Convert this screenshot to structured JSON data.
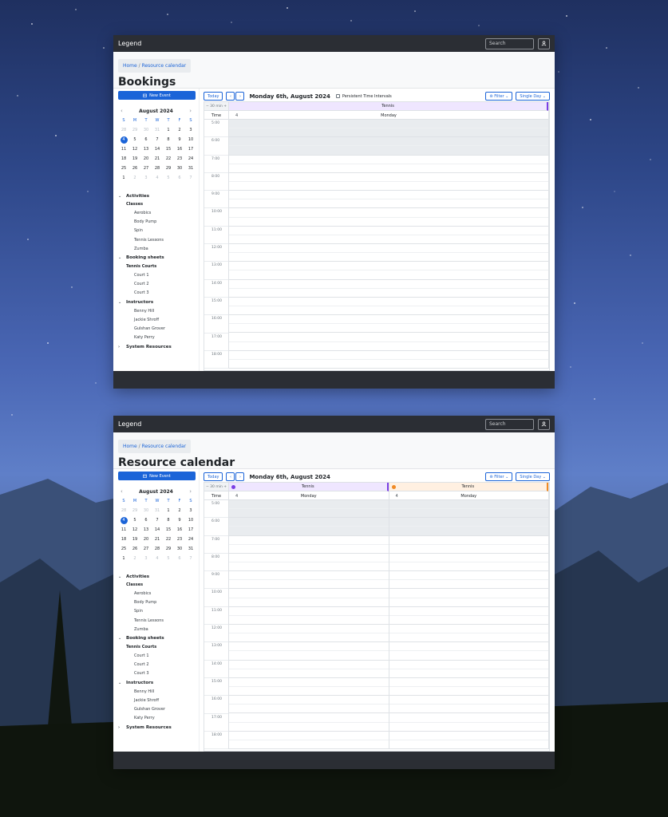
{
  "colors": {
    "accent": "#1b64d8",
    "navbar": "#2b2e34",
    "resource_purple": "#7b3fe4",
    "resource_orange": "#f08a24"
  },
  "navbar": {
    "brand": "Legend",
    "search_placeholder": "Search",
    "user_icon": "user-icon"
  },
  "windows": [
    {
      "breadcrumb": {
        "home": "Home",
        "separator": "/",
        "current": "Resource calendar"
      },
      "title": "Bookings",
      "resources": [
        {
          "name": "Tennis",
          "color": "#7b3fe4",
          "day_num": "4",
          "day": "Monday"
        }
      ]
    },
    {
      "breadcrumb": {
        "home": "Home",
        "separator": "/",
        "current": "Resource calendar"
      },
      "title": "Resource calendar",
      "resources": [
        {
          "name": "Tennis",
          "color": "#7b3fe4",
          "day_num": "4",
          "day": "Monday"
        },
        {
          "name": "Tennis",
          "color": "#f08a24",
          "day_num": "4",
          "day": "Monday"
        }
      ]
    }
  ],
  "sidebar": {
    "new_event": "New Event",
    "month_label": "August 2024",
    "days_of_week": [
      "S",
      "M",
      "T",
      "W",
      "T",
      "F",
      "S"
    ],
    "weeks": [
      [
        "28",
        "29",
        "30",
        "31",
        "1",
        "2",
        "3"
      ],
      [
        "4",
        "5",
        "6",
        "7",
        "8",
        "9",
        "10"
      ],
      [
        "11",
        "12",
        "13",
        "14",
        "15",
        "16",
        "17"
      ],
      [
        "18",
        "19",
        "20",
        "21",
        "22",
        "23",
        "24"
      ],
      [
        "25",
        "26",
        "27",
        "28",
        "29",
        "30",
        "31"
      ],
      [
        "1",
        "2",
        "3",
        "4",
        "5",
        "6",
        "7"
      ]
    ],
    "tree": [
      {
        "label": "Activities",
        "expanded": true,
        "children": [
          {
            "label": "Classes",
            "items": [
              "Aerobics",
              "Body Pump",
              "Spin",
              "Tennis Lessons",
              "Zumba"
            ]
          }
        ]
      },
      {
        "label": "Booking sheets",
        "expanded": true,
        "children": [
          {
            "label": "Tennis Courts",
            "items": [
              "Court 1",
              "Court 2",
              "Court 3"
            ]
          }
        ]
      },
      {
        "label": "Instructors",
        "expanded": true,
        "children": [
          {
            "label": "",
            "items": [
              "Benny Hill",
              "Jackie Shroff",
              "Gulshan Grover",
              "Katy Perry"
            ]
          }
        ]
      },
      {
        "label": "System Resources",
        "expanded": false,
        "children": []
      }
    ]
  },
  "toolbar": {
    "today": "Today",
    "date": "Monday 6th, August 2024",
    "persistent_label": "Persistent Time Intervals",
    "filter": "Filter",
    "view": "Single Day"
  },
  "schedule": {
    "interval": "30 min",
    "time_header": "Time",
    "times": [
      "5:00",
      "6:00",
      "7:00",
      "8:00",
      "9:00",
      "10:00",
      "11:00",
      "12:00",
      "13:00",
      "14:00",
      "15:00",
      "16:00",
      "17:00",
      "18:00"
    ]
  }
}
